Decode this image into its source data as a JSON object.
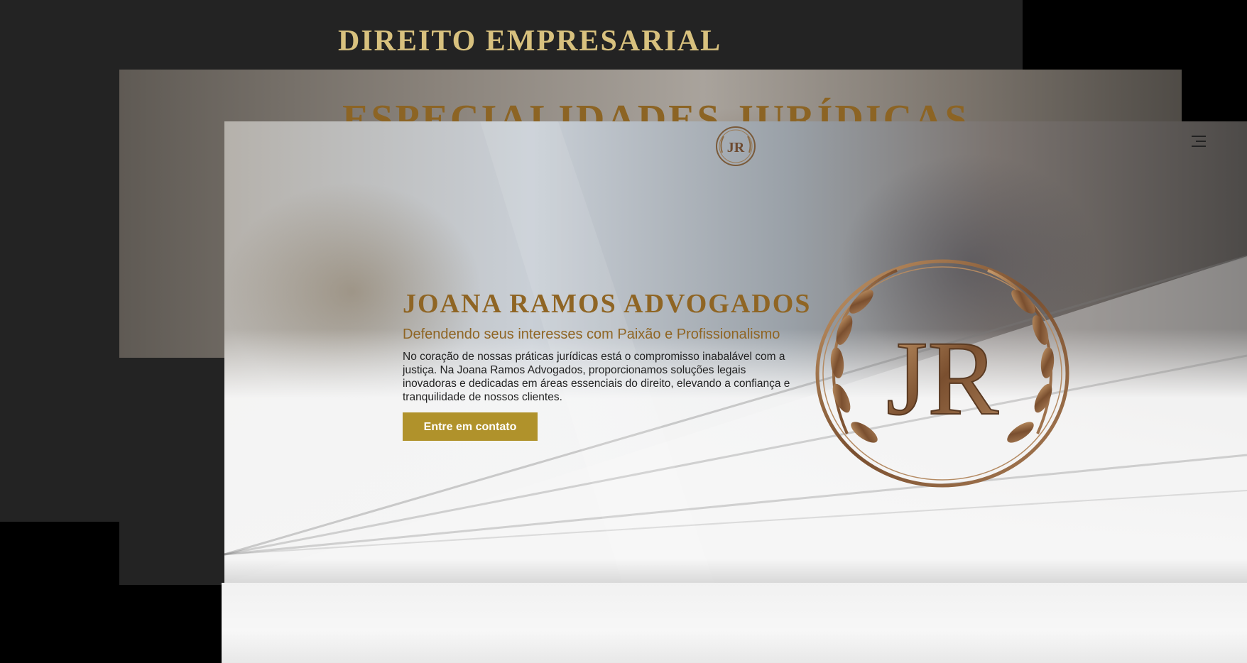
{
  "back_page": {
    "title": "DIREITO EMPRESARIAL"
  },
  "mid_page": {
    "title": "ESPECIALIDADES JURÍDICAS"
  },
  "header": {
    "logo_text": "JR",
    "menu_icon": "hamburger-menu-icon"
  },
  "hero": {
    "title": "JOANA RAMOS ADVOGADOS",
    "subtitle": "Defendendo seus interesses com Paixão e Profissionalismo",
    "body": "No coração de nossas práticas jurídicas está o compromisso inabalável com a justiça. Na Joana Ramos Advogados, proporcionamos soluções legais inovadoras e dedicadas em áreas essenciais do direito, elevando a confiança e tranquilidade de nossos clientes.",
    "cta_label": "Entre em contato",
    "emblem_text": "JR"
  },
  "colors": {
    "gold_text": "#8f6524",
    "light_gold": "#d8c17e",
    "button": "#b0922b",
    "dark_panel": "#232323"
  }
}
